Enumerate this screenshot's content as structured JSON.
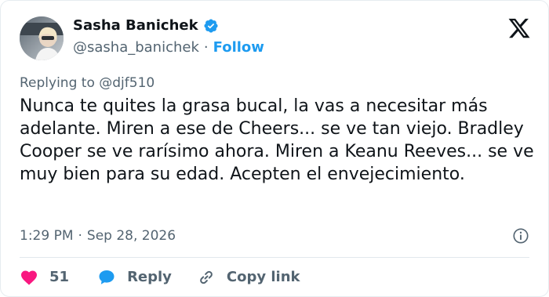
{
  "author": {
    "display_name": "Sasha Banichek",
    "handle": "@sasha_banichek",
    "separator": "·",
    "follow_label": "Follow"
  },
  "reply_to": {
    "prefix": "Replying to",
    "mention": "@djf510"
  },
  "tweet": {
    "text": "Nunca te quites la grasa bucal, la vas a necesitar más adelante. Miren a ese de Cheers... se ve tan viejo. Bradley Cooper se ve rarísimo ahora. Miren a Keanu Reeves... se ve muy bien para su edad. Acepten el envejecimiento."
  },
  "meta": {
    "time": "1:29 PM",
    "separator": "·",
    "date": "Sep 28, 2026"
  },
  "actions": {
    "like_count": "51",
    "reply_label": "Reply",
    "copy_link_label": "Copy link"
  },
  "icons": {
    "verified": "verified-badge-icon",
    "logo": "x-logo-icon",
    "info": "info-icon",
    "like": "heart-icon",
    "reply": "speech-bubble-icon",
    "copy": "link-icon"
  },
  "colors": {
    "accent": "#1d9bf0",
    "like": "#f91880",
    "secondary_text": "#536471",
    "primary_text": "#0f1419"
  }
}
